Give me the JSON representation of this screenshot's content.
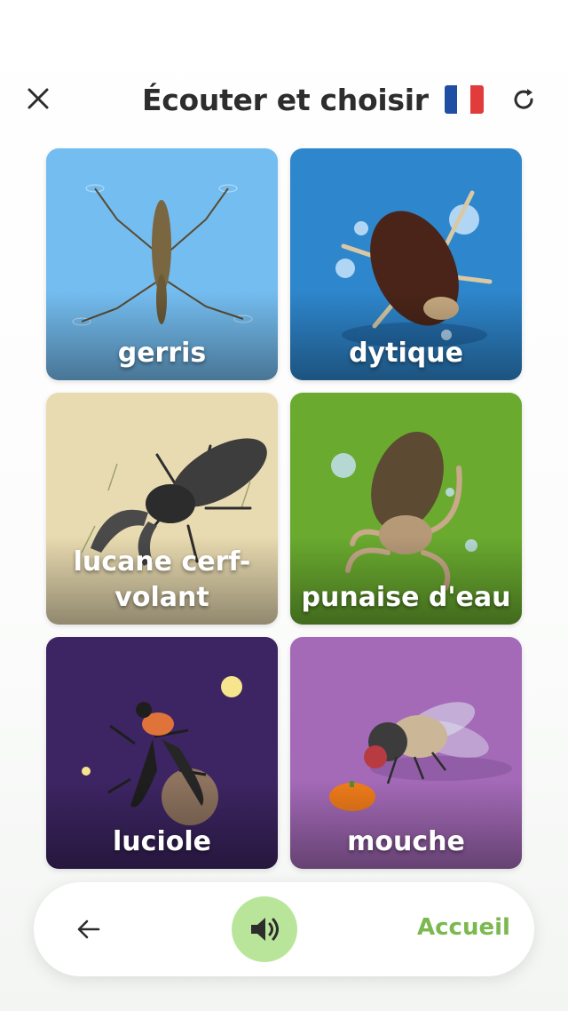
{
  "header": {
    "title": "Écouter et choisir",
    "close_icon": "close-icon",
    "refresh_icon": "refresh-icon",
    "flag": "french-flag",
    "flag_colors": [
      "#1f4fa3",
      "#ffffff",
      "#e23b3b"
    ]
  },
  "cards": [
    {
      "label": "gerris",
      "bg": "#74bdf0"
    },
    {
      "label": "dytique",
      "bg": "#2e86cc"
    },
    {
      "label": "lucane cerf-volant",
      "bg": "#e9dbb1"
    },
    {
      "label": "punaise d'eau",
      "bg": "#6aab2f"
    },
    {
      "label": "luciole",
      "bg": "#3d2563"
    },
    {
      "label": "mouche",
      "bg": "#a46ab8"
    }
  ],
  "bottom_bar": {
    "back_icon": "arrow-left-icon",
    "sound_icon": "speaker-icon",
    "home_label": "Accueil",
    "accent": "#7cb850",
    "sound_bg": "#b9e59a"
  }
}
